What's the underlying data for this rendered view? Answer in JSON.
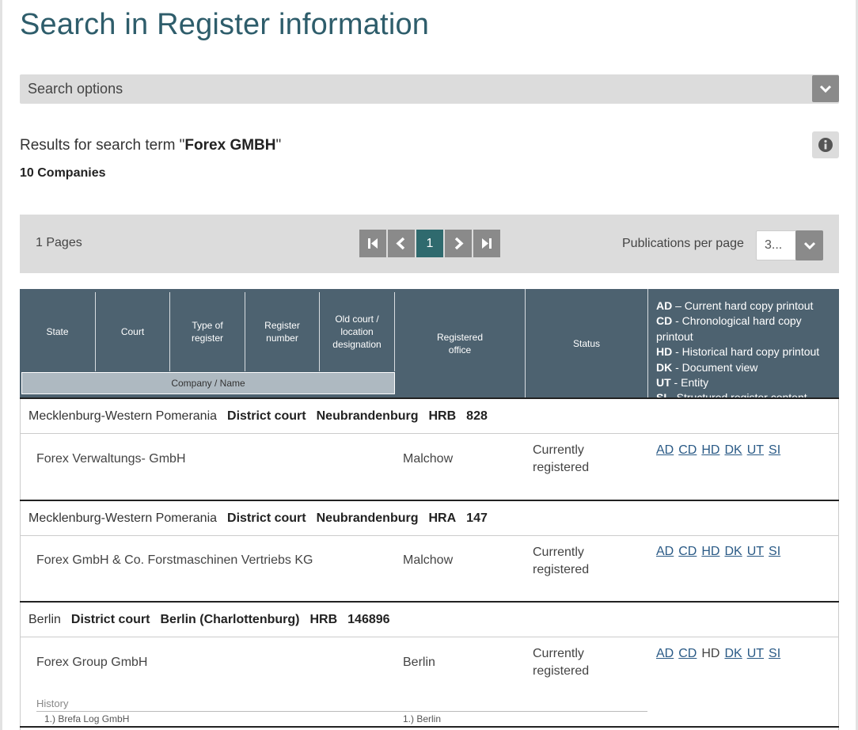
{
  "page": {
    "title": "Search in Register information"
  },
  "search_options": {
    "label": "Search options"
  },
  "results": {
    "prefix": "Results for search term \"",
    "term": "Forex GMBH",
    "suffix": "\"",
    "count": "10 Companies"
  },
  "pager": {
    "pages_label": "1 Pages",
    "current_page": "1",
    "per_page_label": "Publications per page",
    "per_page_value": "3..."
  },
  "table": {
    "headers": {
      "state": "State",
      "court": "Court",
      "type_of_register": "Type of register",
      "register_number": "Register number",
      "old_court": "Old court / location designation",
      "registered_office": "Registered office",
      "status": "Status",
      "company_name": "Company / Name"
    },
    "legend": [
      {
        "code": "AD",
        "text": " – Current hard copy printout"
      },
      {
        "code": "CD",
        "text": " - Chronological hard copy printout"
      },
      {
        "code": "HD",
        "text": " - Historical hard copy printout"
      },
      {
        "code": "DK",
        "text": " - Document view"
      },
      {
        "code": "UT",
        "text": " - Entity"
      },
      {
        "code": "SI",
        "text": " - Structured register content"
      }
    ]
  },
  "groups": [
    {
      "state": "Mecklenburg-Western Pomerania",
      "court_label": "District court",
      "court": "Neubrandenburg",
      "register_type": "HRB",
      "register_number": "828",
      "company": "Forex Verwaltungs- GmbH",
      "office": "Malchow",
      "status_line1": "Currently",
      "status_line2": "registered",
      "links": [
        "AD",
        "CD",
        "HD",
        "DK",
        "UT",
        "SI"
      ]
    },
    {
      "state": "Mecklenburg-Western Pomerania",
      "court_label": "District court",
      "court": "Neubrandenburg",
      "register_type": "HRA",
      "register_number": "147",
      "company": "Forex GmbH & Co. Forstmaschinen Vertriebs KG",
      "office": "Malchow",
      "status_line1": "Currently",
      "status_line2": "registered",
      "links": [
        "AD",
        "CD",
        "HD",
        "DK",
        "UT",
        "SI"
      ]
    },
    {
      "state": "Berlin",
      "court_label": "District court",
      "court": "Berlin (Charlottenburg)",
      "register_type": "HRB",
      "register_number": "146896",
      "company": "Forex Group GmbH",
      "office": "Berlin",
      "status_line1": "Currently",
      "status_line2": "registered",
      "links": [
        "AD",
        "CD",
        "HD",
        "DK",
        "UT",
        "SI"
      ],
      "history_label": "History",
      "history_name": "1.) Brefa Log GmbH",
      "history_office": "1.) Berlin"
    }
  ]
}
